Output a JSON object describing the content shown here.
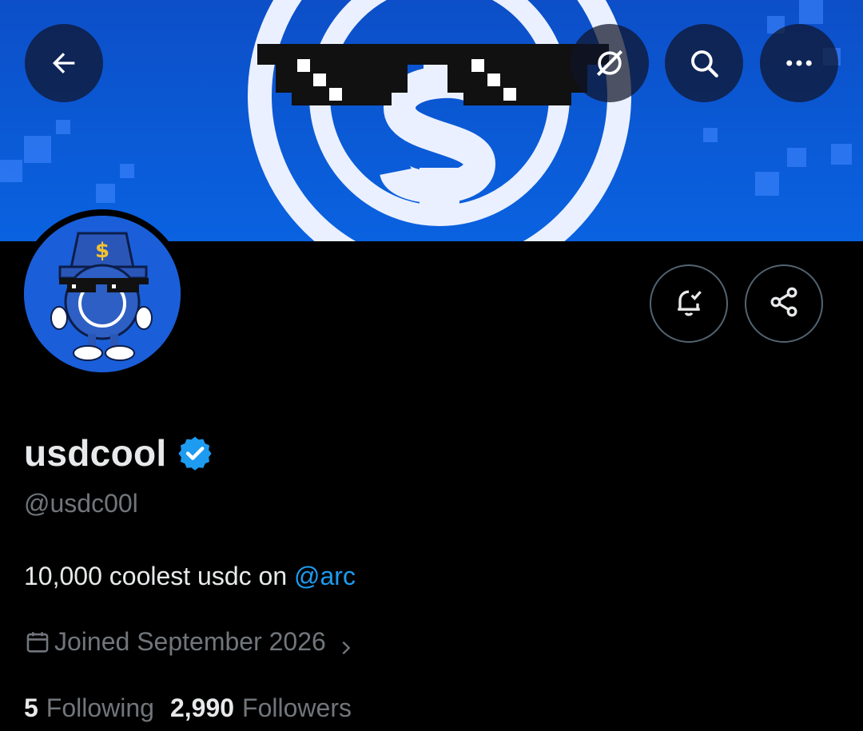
{
  "header": {
    "back_icon": "arrow-left-icon",
    "grok_icon": "grok-icon",
    "search_icon": "search-icon",
    "more_icon": "more-horizontal-icon"
  },
  "actions": {
    "notify_icon": "bell-check-icon",
    "share_icon": "share-icon"
  },
  "profile": {
    "display_name": "usdcool",
    "verified": true,
    "handle": "@usdc00l",
    "bio_text": "10,000 coolest usdc on ",
    "bio_mention": "@arc",
    "joined": "Joined September 2026",
    "following_count": "5",
    "following_label": "Following",
    "followers_count": "2,990",
    "followers_label": "Followers"
  },
  "colors": {
    "background": "#000000",
    "banner_blue": "#0a5ad6",
    "accent": "#1d9bf0",
    "muted_text": "#71767b",
    "primary_text": "#e7e9ea"
  }
}
